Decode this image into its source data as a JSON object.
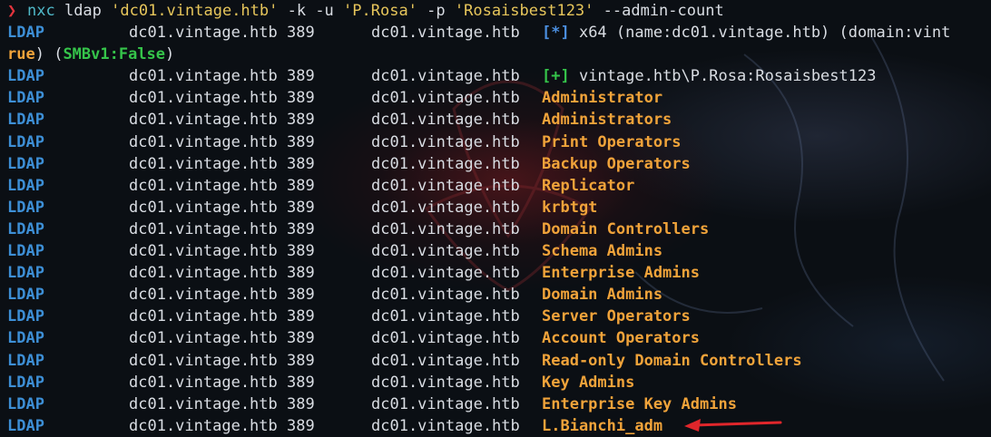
{
  "prompt": {
    "symbol": "❯",
    "command": "nxc",
    "args_pre": " ldap ",
    "target": "'dc01.vintage.htb'",
    "args_mid": " -k -u ",
    "user": "'P.Rosa'",
    "args_mid2": " -p ",
    "password": "'Rosaisbest123'",
    "args_post": " --admin-count"
  },
  "info_line": {
    "proto": "LDAP",
    "host": "dc01.vintage.htb 389",
    "target": "dc01.vintage.htb",
    "marker": "[*]",
    "text": " x64 (name:dc01.vintage.htb) (domain:vint"
  },
  "wrap_line": {
    "bool": "rue",
    "open": ") (",
    "smb": "SMBv1:False",
    "close": ")"
  },
  "auth_line": {
    "proto": "LDAP",
    "host": "dc01.vintage.htb 389",
    "target": "dc01.vintage.htb",
    "marker": "[+]",
    "text": " vintage.htb\\P.Rosa:Rosaisbest123"
  },
  "results": [
    {
      "proto": "LDAP",
      "host": "dc01.vintage.htb 389",
      "target": "dc01.vintage.htb",
      "value": "Administrator"
    },
    {
      "proto": "LDAP",
      "host": "dc01.vintage.htb 389",
      "target": "dc01.vintage.htb",
      "value": "Administrators"
    },
    {
      "proto": "LDAP",
      "host": "dc01.vintage.htb 389",
      "target": "dc01.vintage.htb",
      "value": "Print Operators"
    },
    {
      "proto": "LDAP",
      "host": "dc01.vintage.htb 389",
      "target": "dc01.vintage.htb",
      "value": "Backup Operators"
    },
    {
      "proto": "LDAP",
      "host": "dc01.vintage.htb 389",
      "target": "dc01.vintage.htb",
      "value": "Replicator"
    },
    {
      "proto": "LDAP",
      "host": "dc01.vintage.htb 389",
      "target": "dc01.vintage.htb",
      "value": "krbtgt"
    },
    {
      "proto": "LDAP",
      "host": "dc01.vintage.htb 389",
      "target": "dc01.vintage.htb",
      "value": "Domain Controllers"
    },
    {
      "proto": "LDAP",
      "host": "dc01.vintage.htb 389",
      "target": "dc01.vintage.htb",
      "value": "Schema Admins"
    },
    {
      "proto": "LDAP",
      "host": "dc01.vintage.htb 389",
      "target": "dc01.vintage.htb",
      "value": "Enterprise Admins"
    },
    {
      "proto": "LDAP",
      "host": "dc01.vintage.htb 389",
      "target": "dc01.vintage.htb",
      "value": "Domain Admins"
    },
    {
      "proto": "LDAP",
      "host": "dc01.vintage.htb 389",
      "target": "dc01.vintage.htb",
      "value": "Server Operators"
    },
    {
      "proto": "LDAP",
      "host": "dc01.vintage.htb 389",
      "target": "dc01.vintage.htb",
      "value": "Account Operators"
    },
    {
      "proto": "LDAP",
      "host": "dc01.vintage.htb 389",
      "target": "dc01.vintage.htb",
      "value": "Read-only Domain Controllers"
    },
    {
      "proto": "LDAP",
      "host": "dc01.vintage.htb 389",
      "target": "dc01.vintage.htb",
      "value": "Key Admins"
    },
    {
      "proto": "LDAP",
      "host": "dc01.vintage.htb 389",
      "target": "dc01.vintage.htb",
      "value": "Enterprise Key Admins"
    },
    {
      "proto": "LDAP",
      "host": "dc01.vintage.htb 389",
      "target": "dc01.vintage.htb",
      "value": "L.Bianchi_adm"
    }
  ],
  "annotation": {
    "icon": "red-arrow-icon",
    "color": "#e0262b"
  },
  "colors": {
    "background": "#0b0f14",
    "ldap": "#3d8fd6",
    "value": "#f0a33a",
    "success": "#35c44a",
    "info": "#4b8fe0",
    "prompt": "#e2343d"
  }
}
